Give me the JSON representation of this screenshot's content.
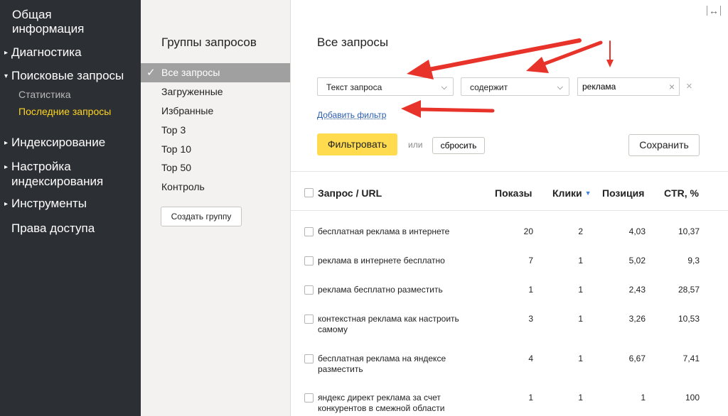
{
  "sidebar": {
    "items": [
      {
        "label": "Общая",
        "label2": "информация"
      },
      {
        "label": "Диагностика"
      },
      {
        "label": "Поисковые запросы"
      },
      {
        "label": "Индексирование"
      },
      {
        "label": "Настройка",
        "label2": "индексирования"
      },
      {
        "label": "Инструменты"
      },
      {
        "label": "Права доступа"
      }
    ],
    "sub": [
      {
        "label": "Статистика"
      },
      {
        "label": "Последние запросы"
      }
    ],
    "arrow_closed": "▸",
    "arrow_open": "▾",
    "active_color": "#ffd41f"
  },
  "groups": {
    "title": "Группы запросов",
    "items": [
      {
        "label": "Все запросы"
      },
      {
        "label": "Загруженные"
      },
      {
        "label": "Избранные"
      },
      {
        "label": "Top 3"
      },
      {
        "label": "Top 10"
      },
      {
        "label": "Top 50"
      },
      {
        "label": "Контроль"
      }
    ],
    "check": "✓",
    "create_button": "Создать группу"
  },
  "main": {
    "expand_icon": "↔",
    "title": "Все запросы",
    "filter": {
      "field": "Текст запроса",
      "operator": "содержит",
      "value": "реклама",
      "clear_icon": "×",
      "remove_icon": "×",
      "chevron": "⌵",
      "add_filter": "Добавить фильтр"
    },
    "buttons": {
      "filter": "Фильтровать",
      "or": "или",
      "reset": "сбросить",
      "save": "Сохранить"
    },
    "table": {
      "headers": {
        "query": "Запрос / URL",
        "shows": "Показы",
        "clicks": "Клики",
        "position": "Позиция",
        "ctr": "CTR, %"
      },
      "sort_icon": "▼",
      "rows": [
        {
          "q1": "бесплатная реклама в интернете",
          "q2": "",
          "shows": "20",
          "clicks": "2",
          "position": "4,03",
          "ctr": "10,37"
        },
        {
          "q1": "реклама в интернете бесплатно",
          "q2": "",
          "shows": "7",
          "clicks": "1",
          "position": "5,02",
          "ctr": "9,3"
        },
        {
          "q1": "реклама бесплатно разместить",
          "q2": "",
          "shows": "1",
          "clicks": "1",
          "position": "2,43",
          "ctr": "28,57"
        },
        {
          "q1": "контекстная реклама как настроить",
          "q2": "самому",
          "shows": "3",
          "clicks": "1",
          "position": "3,26",
          "ctr": "10,53"
        },
        {
          "q1": "бесплатная реклама на яндексе",
          "q2": "разместить",
          "shows": "4",
          "clicks": "1",
          "position": "6,67",
          "ctr": "7,41"
        },
        {
          "q1": "яндекс директ реклама за счет",
          "q2": "конкурентов в смежной области",
          "shows": "1",
          "clicks": "1",
          "position": "1",
          "ctr": "100"
        }
      ]
    }
  },
  "annotation_color": "#e8332a"
}
